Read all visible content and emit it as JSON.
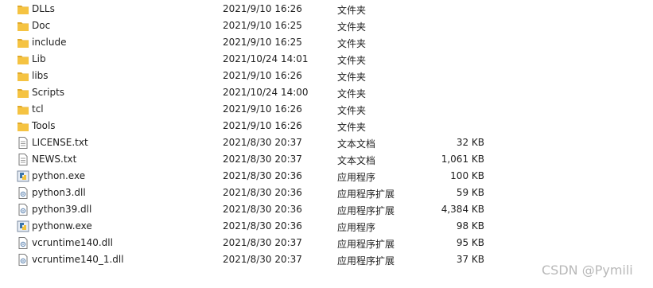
{
  "files": [
    {
      "icon": "folder-icon",
      "name": "DLLs",
      "date": "2021/9/10 16:26",
      "type": "文件夹",
      "size": ""
    },
    {
      "icon": "folder-icon",
      "name": "Doc",
      "date": "2021/9/10 16:25",
      "type": "文件夹",
      "size": ""
    },
    {
      "icon": "folder-icon",
      "name": "include",
      "date": "2021/9/10 16:25",
      "type": "文件夹",
      "size": ""
    },
    {
      "icon": "folder-icon",
      "name": "Lib",
      "date": "2021/10/24 14:01",
      "type": "文件夹",
      "size": ""
    },
    {
      "icon": "folder-icon",
      "name": "libs",
      "date": "2021/9/10 16:26",
      "type": "文件夹",
      "size": ""
    },
    {
      "icon": "folder-icon",
      "name": "Scripts",
      "date": "2021/10/24 14:00",
      "type": "文件夹",
      "size": ""
    },
    {
      "icon": "folder-icon",
      "name": "tcl",
      "date": "2021/9/10 16:26",
      "type": "文件夹",
      "size": ""
    },
    {
      "icon": "folder-icon",
      "name": "Tools",
      "date": "2021/9/10 16:26",
      "type": "文件夹",
      "size": ""
    },
    {
      "icon": "text-file-icon",
      "name": "LICENSE.txt",
      "date": "2021/8/30 20:37",
      "type": "文本文档",
      "size": "32 KB"
    },
    {
      "icon": "text-file-icon",
      "name": "NEWS.txt",
      "date": "2021/8/30 20:37",
      "type": "文本文档",
      "size": "1,061 KB"
    },
    {
      "icon": "python-exe-icon",
      "name": "python.exe",
      "date": "2021/8/30 20:36",
      "type": "应用程序",
      "size": "100 KB"
    },
    {
      "icon": "dll-file-icon",
      "name": "python3.dll",
      "date": "2021/8/30 20:36",
      "type": "应用程序扩展",
      "size": "59 KB"
    },
    {
      "icon": "dll-file-icon",
      "name": "python39.dll",
      "date": "2021/8/30 20:36",
      "type": "应用程序扩展",
      "size": "4,384 KB"
    },
    {
      "icon": "python-exe-icon",
      "name": "pythonw.exe",
      "date": "2021/8/30 20:36",
      "type": "应用程序",
      "size": "98 KB"
    },
    {
      "icon": "dll-file-icon",
      "name": "vcruntime140.dll",
      "date": "2021/8/30 20:37",
      "type": "应用程序扩展",
      "size": "95 KB"
    },
    {
      "icon": "dll-file-icon",
      "name": "vcruntime140_1.dll",
      "date": "2021/8/30 20:37",
      "type": "应用程序扩展",
      "size": "37 KB"
    }
  ],
  "watermark": "CSDN @Pymili",
  "colors": {
    "folder": "#f5c342",
    "folder_dark": "#e0a92a",
    "text": "#1e1e1e",
    "watermark": "#b8b8b8"
  }
}
